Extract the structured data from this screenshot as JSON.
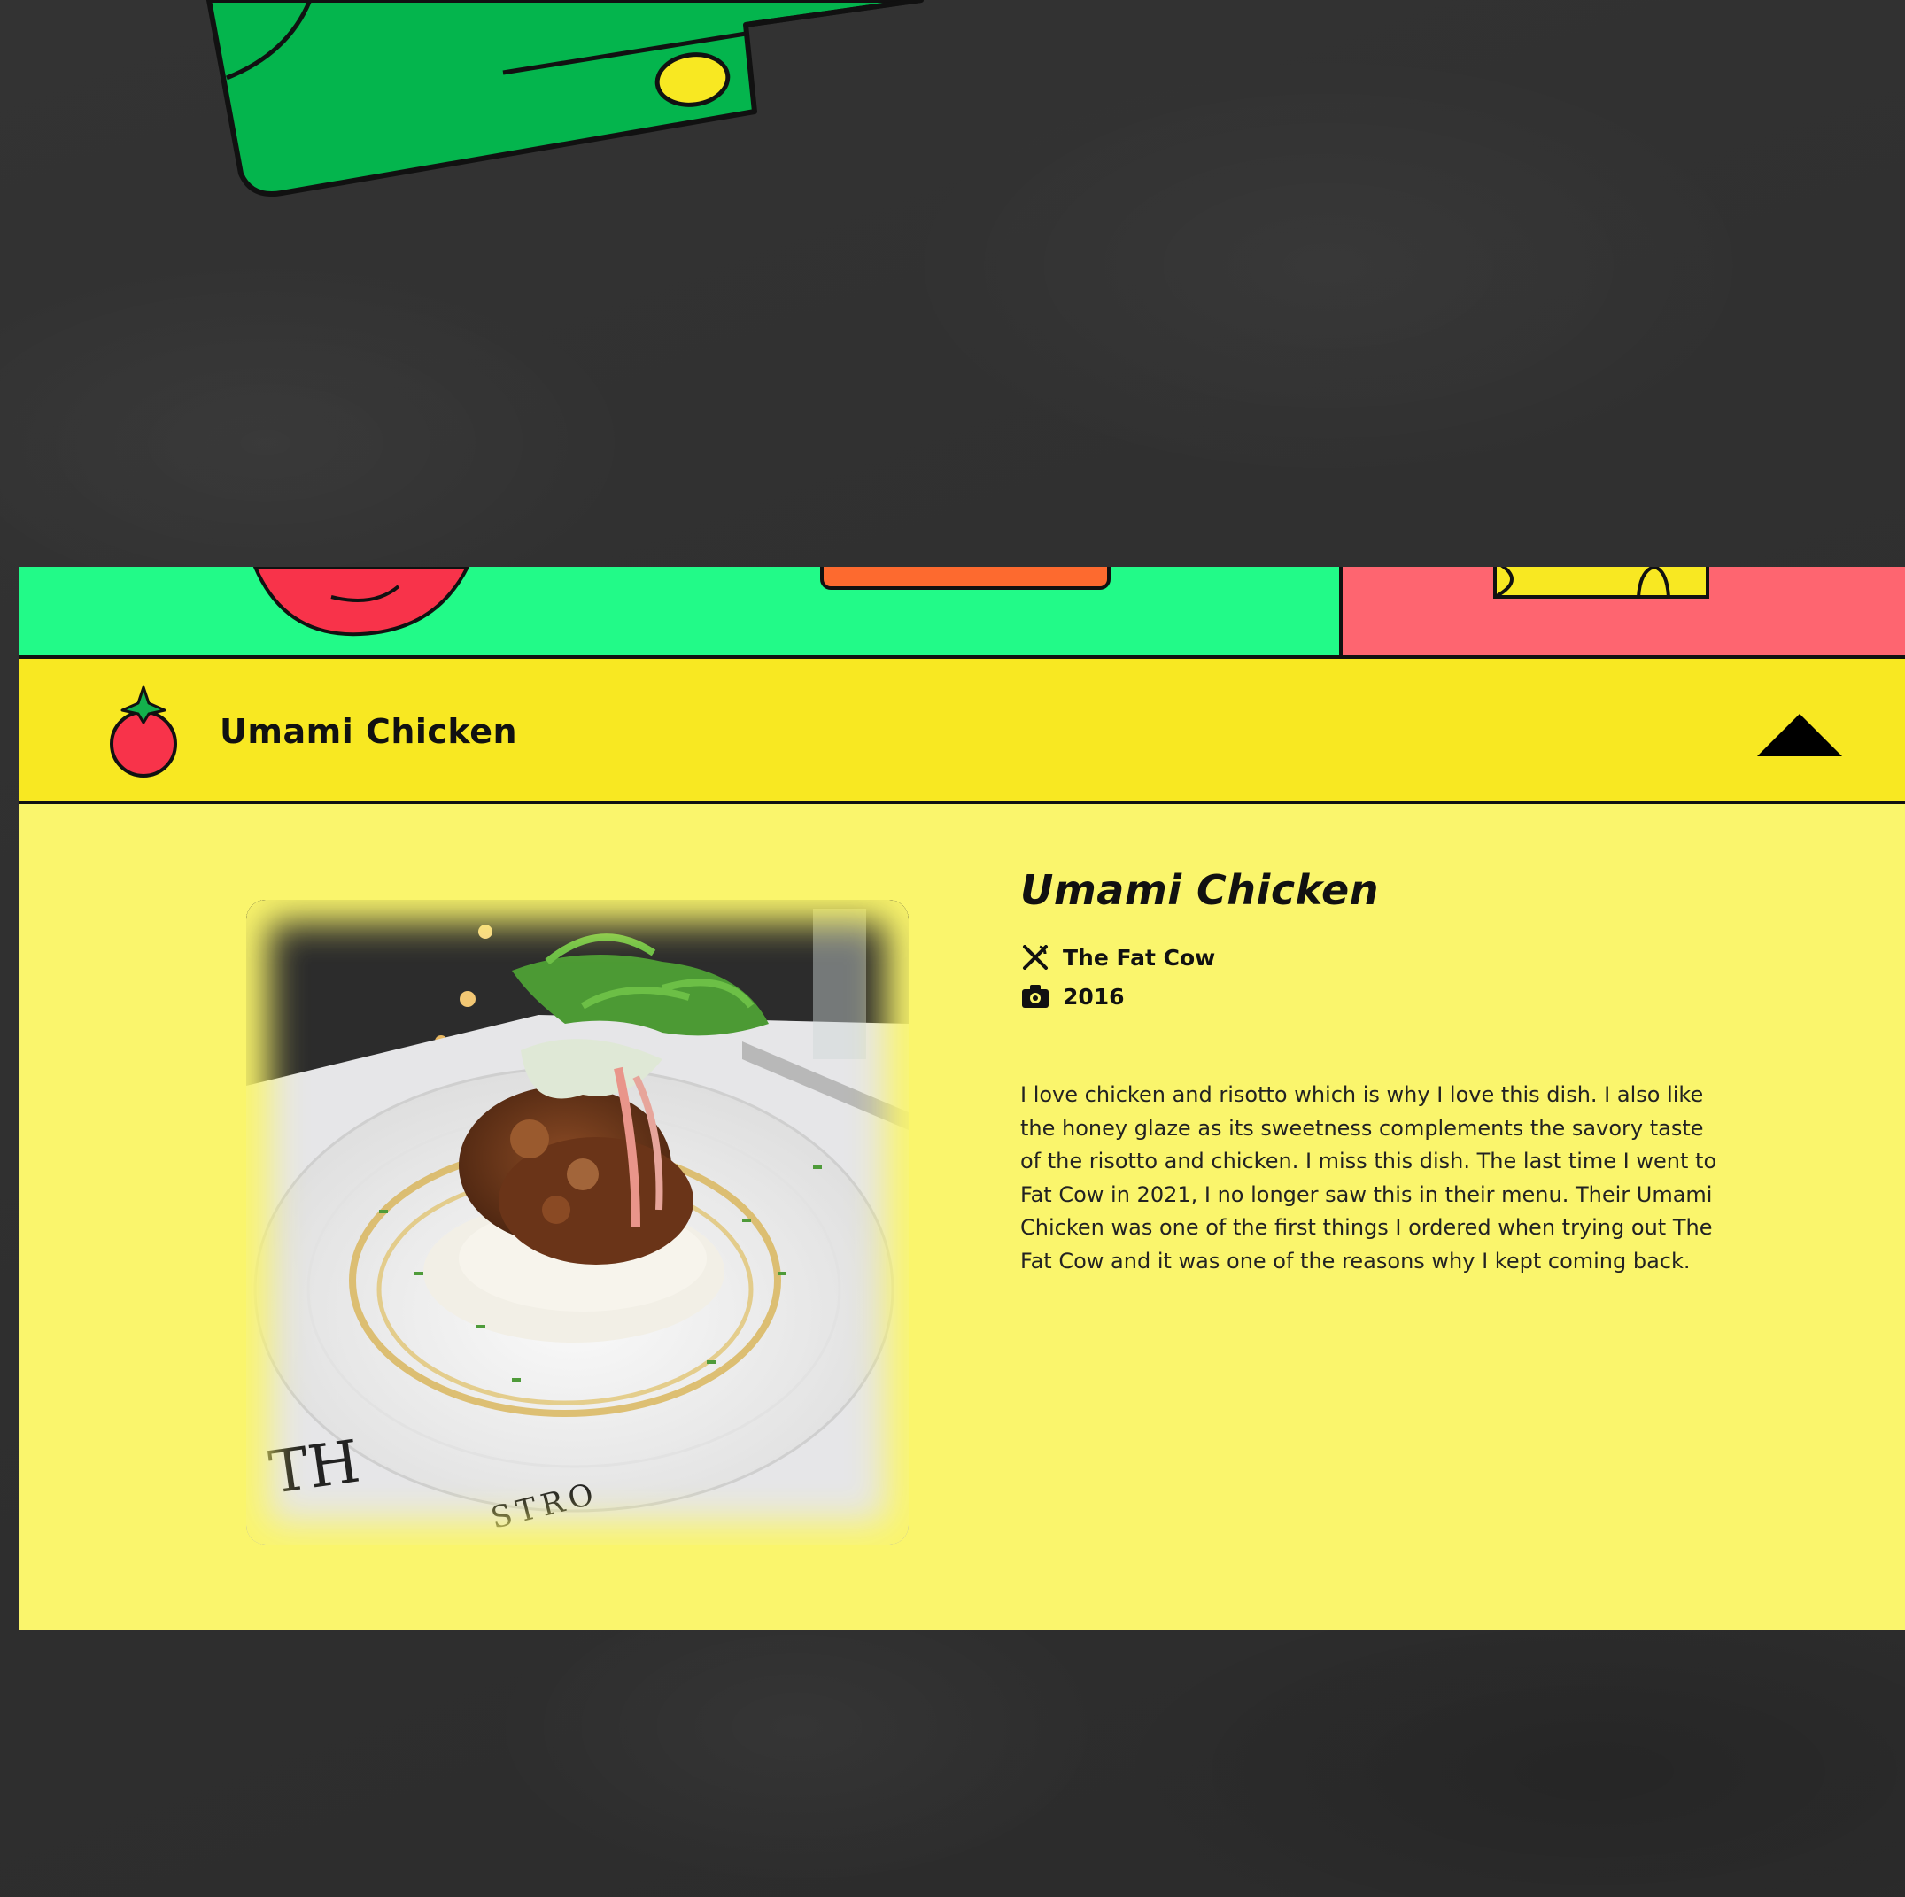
{
  "header": {
    "title": "Umami Chicken",
    "icon": "tomato-icon",
    "toggle_icon": "collapse-arrow-icon"
  },
  "dish": {
    "title": "Umami Chicken",
    "restaurant": "The Fat Cow",
    "restaurant_icon": "utensils-icon",
    "year": "2016",
    "year_icon": "camera-icon",
    "description": "I love chicken and risotto which is why I love this dish. I also like the honey glaze as its sweetness complements the savory taste of the risotto and chicken. I miss this dish. The last time I went to Fat Cow in 2021, I no longer saw this in their menu. Their Umami Chicken was one of the first things I ordered when trying out The Fat Cow and it was one of the reasons why I kept coming back."
  },
  "colors": {
    "background": "#2f2f2f",
    "header_yellow": "#f8e822",
    "panel_yellow": "#faf56c",
    "strip_green": "#22fa88",
    "strip_pink": "#fe6570",
    "tomato_red": "#f8334a",
    "leaf_green": "#13b04c",
    "card_green": "#04b54d"
  }
}
